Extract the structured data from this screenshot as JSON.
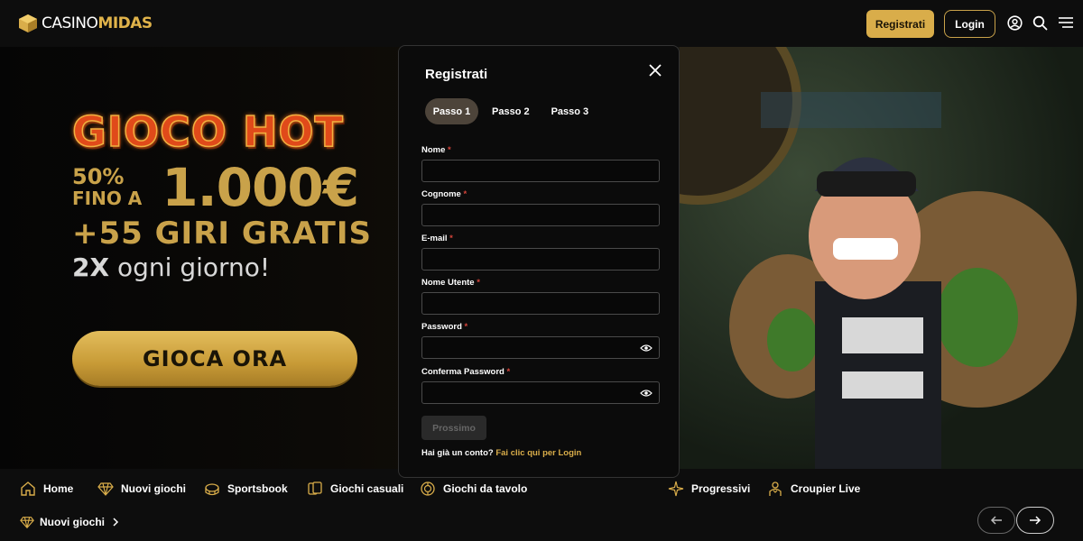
{
  "header": {
    "logo_prefix": "CASINO",
    "logo_brand": "MIDAS",
    "register_label": "Registrati",
    "login_label": "Login",
    "icons": [
      "user-circle-icon",
      "search-icon",
      "menu-icon"
    ]
  },
  "hero": {
    "headline": "GIOCO HOT",
    "percent": "50%",
    "upto": "FINO A",
    "amount": "1.000€",
    "spins": "+55 GIRI GRATIS",
    "daily_bold": "2X",
    "daily_text": "ogni giorno!",
    "cta_label": "GIOCA ORA"
  },
  "modal": {
    "title": "Registrati",
    "steps": [
      "Passo 1",
      "Passo 2",
      "Passo 3"
    ],
    "active_step": 1,
    "fields": [
      {
        "label": "Nome",
        "required": "*",
        "value": ""
      },
      {
        "label": "Cognome",
        "required": "*",
        "value": ""
      },
      {
        "label": "E-mail",
        "required": "*",
        "value": ""
      },
      {
        "label": "Nome Utente",
        "required": "*",
        "value": ""
      },
      {
        "label": "Password",
        "required": "*",
        "value": ""
      },
      {
        "label": "Conferma Password",
        "required": "*",
        "value": ""
      }
    ],
    "next_label": "Prossimo",
    "has_account": "Hai già un conto?",
    "login_link": "Fai clic qui per Login"
  },
  "bottom_nav": {
    "items": [
      {
        "label": "Home",
        "icon": "home-icon"
      },
      {
        "label": "Nuovi giochi",
        "icon": "diamond-icon"
      },
      {
        "label": "Sportsbook",
        "icon": "stadium-icon"
      },
      {
        "label": "Giochi casuali",
        "icon": "cards-icon"
      },
      {
        "label": "Giochi da tavolo",
        "icon": "chip-icon"
      },
      {
        "label": "Progressivi",
        "icon": "sparkle-icon"
      },
      {
        "label": "Croupier Live",
        "icon": "croupier-icon"
      }
    ],
    "section_label": "Nuovi giochi"
  },
  "colors": {
    "gold": "#d9ad4a",
    "required_star": "#d6443a",
    "background": "#0d0d0d"
  }
}
